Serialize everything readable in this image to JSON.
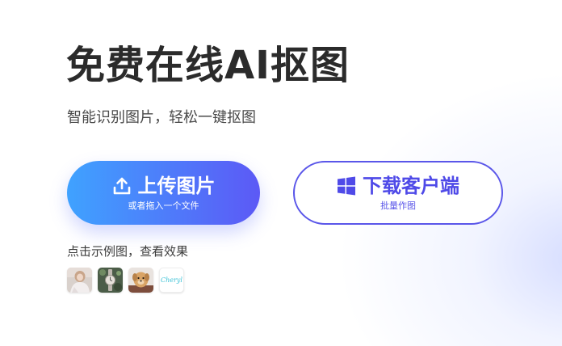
{
  "hero": {
    "title": "免费在线AI抠图",
    "subtitle": "智能识别图片，轻松一键抠图"
  },
  "upload_button": {
    "label": "上传图片",
    "sublabel": "或者拖入一个文件",
    "icon": "upload-icon"
  },
  "download_button": {
    "label": "下载客户端",
    "sublabel": "批量作图",
    "icon": "windows-icon"
  },
  "examples": {
    "label": "点击示例图，查看效果",
    "items": [
      {
        "name": "example-woman-portrait"
      },
      {
        "name": "example-watch"
      },
      {
        "name": "example-dog"
      },
      {
        "name": "example-text-logo",
        "text": "Cheryl"
      }
    ]
  },
  "colors": {
    "accent_start": "#3fa2ff",
    "accent_end": "#5c59f6",
    "outline_accent": "#5a56e9",
    "title": "#2b2b2b"
  }
}
